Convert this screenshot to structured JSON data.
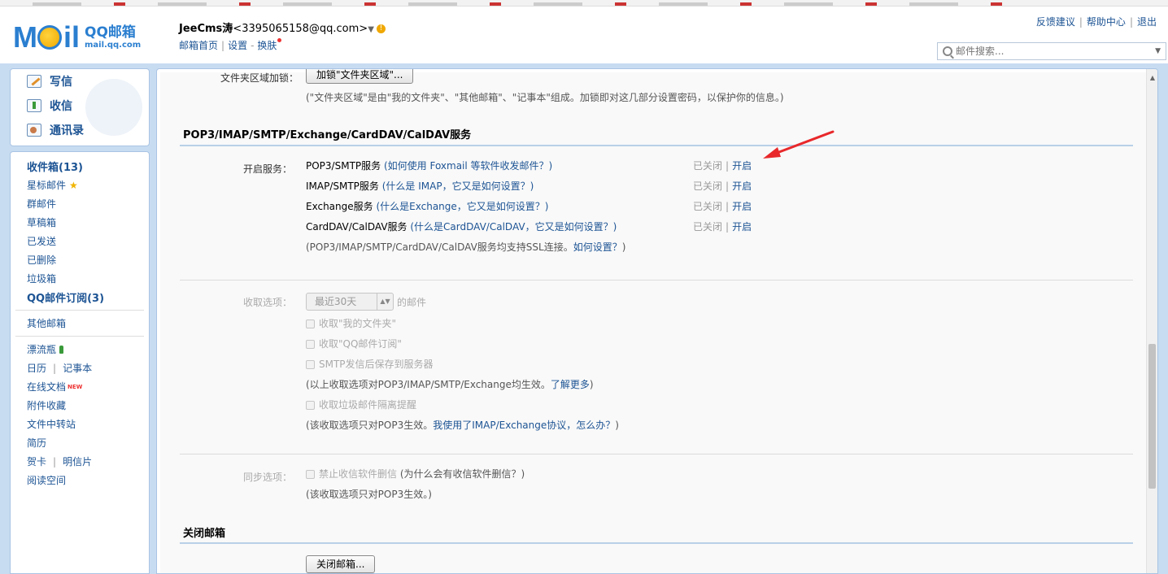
{
  "header": {
    "logo_brand": "QQ邮箱",
    "logo_domain": "mail.qq.com",
    "user_name": "JeeCms涛",
    "user_email": "<3395065158@qq.com>",
    "user_caret": "▼",
    "links": [
      "邮箱首页",
      "设置",
      "换肤"
    ],
    "top_links": [
      "反馈建议",
      "帮助中心",
      "退出"
    ],
    "search_placeholder": "邮件搜索..."
  },
  "sidebar": {
    "actions": [
      {
        "label": "写信",
        "icon": "write-icon"
      },
      {
        "label": "收信",
        "icon": "inbox-download-icon"
      },
      {
        "label": "通讯录",
        "icon": "contacts-icon"
      }
    ],
    "folders": {
      "inbox": "收件箱(13)",
      "starred": "星标邮件",
      "group": "群邮件",
      "drafts": "草稿箱",
      "sent": "已发送",
      "deleted": "已删除",
      "spam": "垃圾箱",
      "subscriptions": "QQ邮件订阅(3)",
      "other": "其他邮箱",
      "bottle": "漂流瓶",
      "calendar": "日历",
      "notes": "记事本",
      "docs": "在线文档",
      "docs_badge": "NEW",
      "attachments": "附件收藏",
      "transfer": "文件中转站",
      "resume": "简历",
      "greeting": "贺卡",
      "postcard": "明信片",
      "reading": "阅读空间"
    }
  },
  "settings": {
    "folder_lock_label": "文件夹区域加锁：",
    "folder_lock_button": "加锁\"文件夹区域\"...",
    "folder_lock_hint": "(\"文件夹区域\"是由\"我的文件夹\"、\"其他邮箱\"、\"记事本\"组成。加锁即对这几部分设置密码，以保护你的信息。)",
    "pop_section_title": "POP3/IMAP/SMTP/Exchange/CardDAV/CalDAV服务",
    "enable_label": "开启服务：",
    "services": [
      {
        "name": "POP3/SMTP服务",
        "help": "(如何使用 Foxmail 等软件收发邮件？)",
        "status": "已关闭",
        "sep": "|",
        "action": "开启"
      },
      {
        "name": "IMAP/SMTP服务",
        "help": "(什么是 IMAP，它又是如何设置？)",
        "status": "已关闭",
        "sep": "|",
        "action": "开启"
      },
      {
        "name": "Exchange服务",
        "help": "(什么是Exchange，它又是如何设置？)",
        "status": "已关闭",
        "sep": "|",
        "action": "开启"
      },
      {
        "name": "CardDAV/CalDAV服务",
        "help": "(什么是CardDAV/CalDAV，它又是如何设置？)",
        "status": "已关闭",
        "sep": "|",
        "action": "开启"
      }
    ],
    "ssl_hint_prefix": "(POP3/IMAP/SMTP/CardDAV/CalDAV服务均支持SSL连接。",
    "ssl_hint_link": "如何设置？",
    "ssl_hint_suffix": ")",
    "receive_label": "收取选项：",
    "receive_select": "最近30天",
    "receive_suffix": "的邮件",
    "receive_options": [
      "收取\"我的文件夹\"",
      "收取\"QQ邮件订阅\"",
      "SMTP发信后保存到服务器"
    ],
    "receive_hint_prefix": "(以上收取选项对POP3/IMAP/SMTP/Exchange均生效。",
    "receive_hint_link": "了解更多",
    "receive_hint_suffix": ")",
    "spam_option": "收取垃圾邮件隔离提醒",
    "spam_hint_prefix": "(该收取选项只对POP3生效。",
    "spam_hint_link": "我使用了IMAP/Exchange协议，怎么办？",
    "spam_hint_suffix": ")",
    "sync_label": "同步选项：",
    "sync_option": "禁止收信软件删信",
    "sync_help": "(为什么会有收信软件删信？)",
    "sync_hint": "(该收取选项只对POP3生效。)",
    "close_section_title": "关闭邮箱",
    "close_button": "关闭邮箱..."
  },
  "colors": {
    "accent": "#1d5494",
    "frame": "#c8dcf1",
    "annotation_arrow": "#e8282b"
  }
}
